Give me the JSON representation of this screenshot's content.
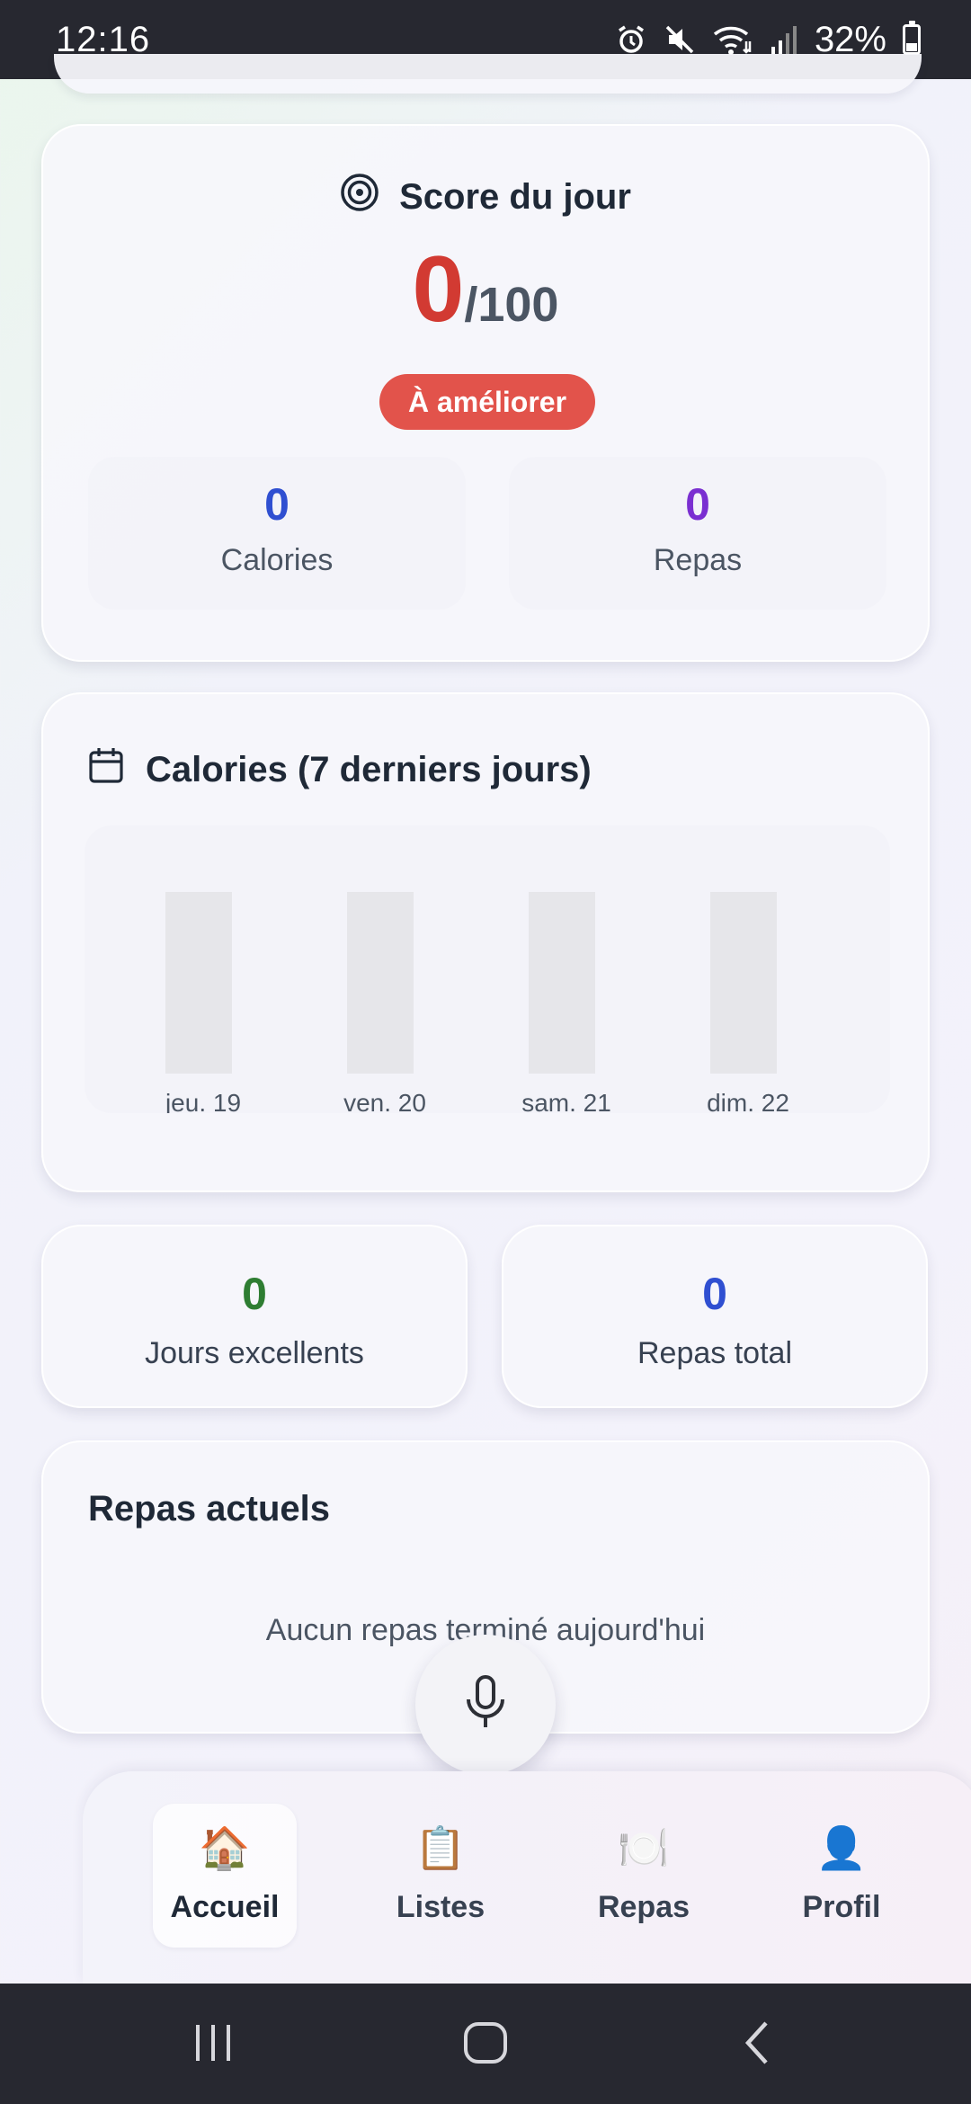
{
  "status_bar": {
    "time": "12:16",
    "battery": "32%",
    "icons": [
      "alarm-icon",
      "mute-icon",
      "wifi-icon",
      "signal-icon",
      "battery-icon"
    ]
  },
  "score_card": {
    "title": "Score du jour",
    "icon": "target-icon",
    "score": "0",
    "score_max": "/100",
    "badge": "À améliorer",
    "badge_color": "#e2534b",
    "stats": [
      {
        "value": "0",
        "label": "Calories",
        "color": "#2f4fd1"
      },
      {
        "value": "0",
        "label": "Repas",
        "color": "#7a2fd1"
      }
    ]
  },
  "chart_card": {
    "title": "Calories (7 derniers jours)",
    "icon": "calendar-icon"
  },
  "chart_data": {
    "type": "bar",
    "categories": [
      "jeu. 19",
      "ven. 20",
      "sam. 21",
      "dim. 22"
    ],
    "values": [
      0,
      0,
      0,
      0
    ],
    "title": "Calories (7 derniers jours)",
    "xlabel": "",
    "ylabel": "",
    "grid": false,
    "bar_color": "#e6e6ea"
  },
  "summary": [
    {
      "value": "0",
      "label": "Jours excellents",
      "color": "#2e7d32"
    },
    {
      "value": "0",
      "label": "Repas total",
      "color": "#2f4fd1"
    }
  ],
  "meals_card": {
    "title": "Repas actuels",
    "empty_text": "Aucun repas terminé aujourd'hui"
  },
  "mic": {
    "icon": "microphone-icon"
  },
  "bottom_nav": [
    {
      "label": "Accueil",
      "icon": "🏠",
      "active": true
    },
    {
      "label": "Listes",
      "icon": "📋",
      "active": false
    },
    {
      "label": "Repas",
      "icon": "🍽️",
      "active": false
    },
    {
      "label": "Profil",
      "icon": "👤",
      "active": false
    }
  ],
  "system_nav": [
    "recent-apps-icon",
    "home-icon",
    "back-icon"
  ]
}
